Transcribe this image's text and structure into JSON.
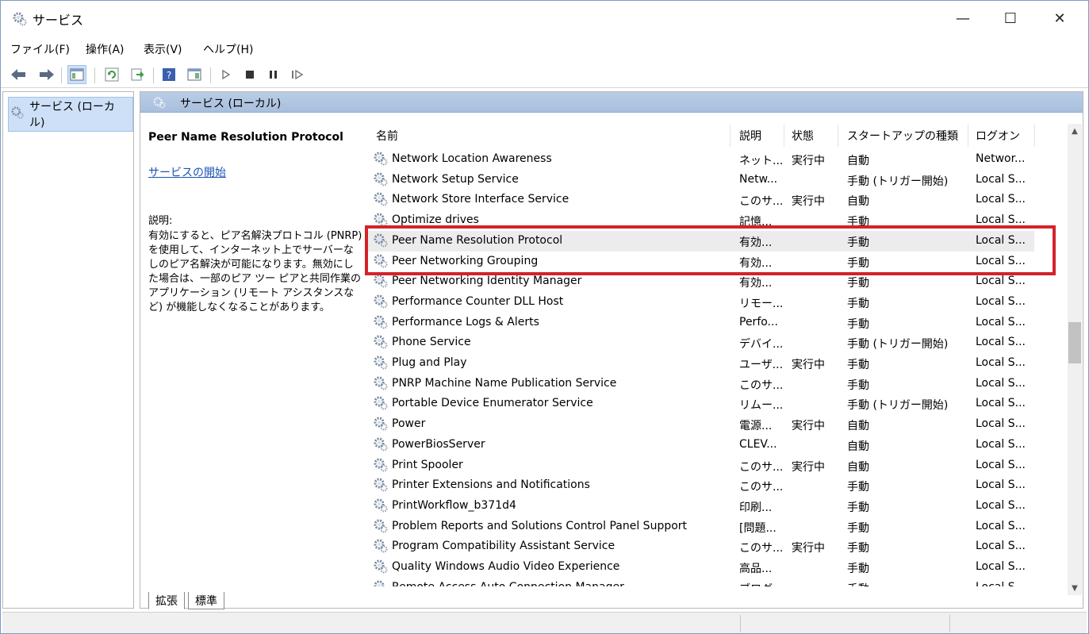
{
  "window": {
    "title": "サービス",
    "controls": {
      "minimize": "—",
      "maximize": "☐",
      "close": "✕"
    }
  },
  "menu": {
    "items": [
      {
        "label": "ファイル(F)"
      },
      {
        "label": "操作(A)"
      },
      {
        "label": "表示(V)"
      },
      {
        "label": "ヘルプ(H)"
      }
    ]
  },
  "toolbar": {
    "icons": [
      "back-icon",
      "forward-icon",
      "console-tree-icon",
      "refresh-icon",
      "export-icon",
      "help-icon",
      "properties-icon",
      "play-icon",
      "stop-icon",
      "pause-icon",
      "restart-icon"
    ]
  },
  "tree": {
    "root_label": "サービス (ローカル)"
  },
  "pane": {
    "header_title": "サービス (ローカル)"
  },
  "details": {
    "service_name": "Peer Name Resolution Protocol",
    "start_link": "サービスの開始",
    "description_label": "説明:",
    "description_text": "有効にすると、ピア名解決プロトコル (PNRP) を使用して、インターネット上でサーバーなしのピア名解決が可能になります。無効にした場合は、一部のピア ツー ピアと共同作業のアプリケーション (リモート アシスタンスなど) が機能しなくなることがあります。"
  },
  "list": {
    "sort_indicator": "^",
    "columns": {
      "name": "名前",
      "description": "説明",
      "status": "状態",
      "startup": "スタートアップの種類",
      "logon": "ログオン"
    },
    "rows": [
      {
        "name": "Network Location Awareness",
        "description": "ネット...",
        "status": "実行中",
        "startup": "自動",
        "logon": "Networ..."
      },
      {
        "name": "Network Setup Service",
        "description": "Netw...",
        "status": "",
        "startup": "手動 (トリガー開始)",
        "logon": "Local S..."
      },
      {
        "name": "Network Store Interface Service",
        "description": "このサ...",
        "status": "実行中",
        "startup": "自動",
        "logon": "Local S..."
      },
      {
        "name": "Optimize drives",
        "description": "記憶...",
        "status": "",
        "startup": "手動",
        "logon": "Local S..."
      },
      {
        "name": "Peer Name Resolution Protocol",
        "description": "有効...",
        "status": "",
        "startup": "手動",
        "logon": "Local S...",
        "selected": true
      },
      {
        "name": "Peer Networking Grouping",
        "description": "有効...",
        "status": "",
        "startup": "手動",
        "logon": "Local S..."
      },
      {
        "name": "Peer Networking Identity Manager",
        "description": "有効...",
        "status": "",
        "startup": "手動",
        "logon": "Local S..."
      },
      {
        "name": "Performance Counter DLL Host",
        "description": "リモー...",
        "status": "",
        "startup": "手動",
        "logon": "Local S..."
      },
      {
        "name": "Performance Logs & Alerts",
        "description": "Perfo...",
        "status": "",
        "startup": "手動",
        "logon": "Local S..."
      },
      {
        "name": "Phone Service",
        "description": "デバイ...",
        "status": "",
        "startup": "手動 (トリガー開始)",
        "logon": "Local S..."
      },
      {
        "name": "Plug and Play",
        "description": "ユーザ...",
        "status": "実行中",
        "startup": "手動",
        "logon": "Local S..."
      },
      {
        "name": "PNRP Machine Name Publication Service",
        "description": "このサ...",
        "status": "",
        "startup": "手動",
        "logon": "Local S..."
      },
      {
        "name": "Portable Device Enumerator Service",
        "description": "リムー...",
        "status": "",
        "startup": "手動 (トリガー開始)",
        "logon": "Local S..."
      },
      {
        "name": "Power",
        "description": "電源...",
        "status": "実行中",
        "startup": "自動",
        "logon": "Local S..."
      },
      {
        "name": "PowerBiosServer",
        "description": "CLEV...",
        "status": "",
        "startup": "自動",
        "logon": "Local S..."
      },
      {
        "name": "Print Spooler",
        "description": "このサ...",
        "status": "実行中",
        "startup": "自動",
        "logon": "Local S..."
      },
      {
        "name": "Printer Extensions and Notifications",
        "description": "このサ...",
        "status": "",
        "startup": "手動",
        "logon": "Local S..."
      },
      {
        "name": "PrintWorkflow_b371d4",
        "description": "印刷...",
        "status": "",
        "startup": "手動",
        "logon": "Local S..."
      },
      {
        "name": "Problem Reports and Solutions Control Panel Support",
        "description": "[問題...",
        "status": "",
        "startup": "手動",
        "logon": "Local S..."
      },
      {
        "name": "Program Compatibility Assistant Service",
        "description": "このサ...",
        "status": "実行中",
        "startup": "手動",
        "logon": "Local S..."
      },
      {
        "name": "Quality Windows Audio Video Experience",
        "description": "高品...",
        "status": "",
        "startup": "手動",
        "logon": "Local S..."
      },
      {
        "name": "Remote Access Auto Connection Manager",
        "description": "ブログ...",
        "status": "",
        "startup": "手動",
        "logon": "Local S..."
      }
    ]
  },
  "tabs": [
    {
      "label": "拡張",
      "active": true
    },
    {
      "label": "標準",
      "active": false
    }
  ],
  "colors": {
    "highlight": "#d3232a",
    "header_bg": "#b9cde6",
    "link": "#1a55b5"
  }
}
